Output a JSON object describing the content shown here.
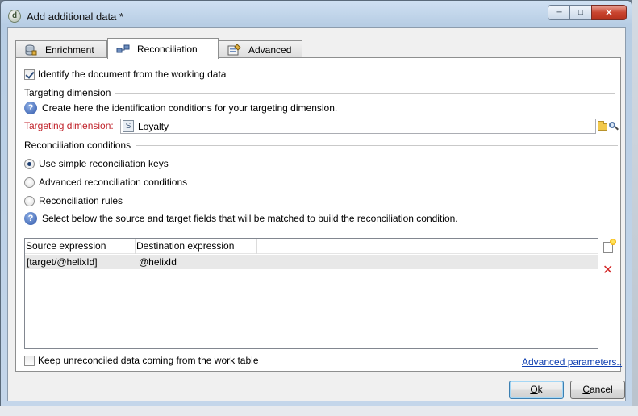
{
  "window": {
    "title": "Add additional data *",
    "app_icon_letter": "d",
    "controls": {
      "minimize": "─",
      "maximize": "□",
      "close": "✕"
    }
  },
  "tabs": [
    {
      "label": "Enrichment",
      "icon": "database-icon",
      "active": false
    },
    {
      "label": "Reconciliation",
      "icon": "link-icon",
      "active": true
    },
    {
      "label": "Advanced",
      "icon": "advanced-settings-icon",
      "active": false
    }
  ],
  "reconciliation": {
    "identify_checkbox": {
      "label": "Identify the document from the working data",
      "checked": true
    },
    "targeting_section": {
      "heading": "Targeting dimension",
      "help_text": "Create here the identification conditions for your targeting dimension.",
      "field_label": "Targeting dimension:",
      "field_value": "Loyalty",
      "schema_icon_glyph": "S"
    },
    "conditions_section": {
      "heading": "Reconciliation conditions",
      "options": [
        {
          "label": "Use simple reconciliation keys",
          "selected": true
        },
        {
          "label": "Advanced reconciliation conditions",
          "selected": false
        },
        {
          "label": "Reconciliation rules",
          "selected": false
        }
      ],
      "help_text": "Select below the source and target fields that will be matched to build the reconciliation condition."
    },
    "grid": {
      "columns": [
        "Source expression",
        "Destination expression"
      ],
      "rows": [
        [
          "[target/@helixId]",
          "@helixId"
        ]
      ]
    },
    "keep_checkbox": {
      "label": "Keep unreconciled data coming from the work table",
      "checked": false
    },
    "advanced_link": "Advanced parameters.."
  },
  "buttons": {
    "ok": {
      "accel": "O",
      "rest": "k"
    },
    "cancel": {
      "accel": "C",
      "rest": "ancel"
    }
  },
  "colors": {
    "required_label": "#c0222a",
    "link": "#0f3fb1",
    "selected_row": "#e8e8e8"
  }
}
